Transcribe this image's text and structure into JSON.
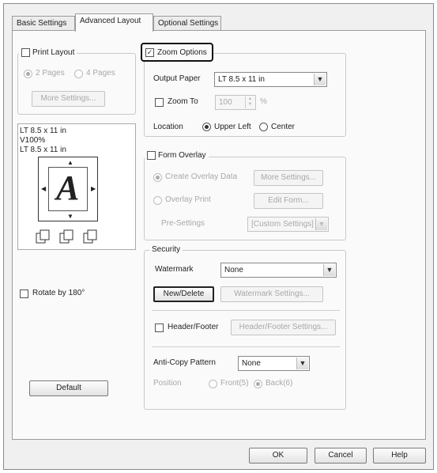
{
  "tabs": {
    "basic": "Basic Settings",
    "advanced": "Advanced Layout",
    "optional": "Optional Settings"
  },
  "print_layout": {
    "label": "Print Layout",
    "checked": false,
    "pages2": "2 Pages",
    "pages4": "4 Pages",
    "more_settings": "More Settings..."
  },
  "preview": {
    "line1": "LT 8.5 x 11 in",
    "line2": "V100%",
    "line3": "LT 8.5 x 11 in",
    "letter": "A"
  },
  "rotate": {
    "label": "Rotate by 180°",
    "checked": false
  },
  "default_button": "Default",
  "zoom": {
    "label": "Zoom Options",
    "checked": true,
    "output_paper_label": "Output Paper",
    "output_paper_value": "LT 8.5 x 11 in",
    "zoom_to_label": "Zoom To",
    "zoom_to_value": "100",
    "zoom_unit": "%",
    "location_label": "Location",
    "upper_left": "Upper Left",
    "center": "Center",
    "checkmark": "✓"
  },
  "form_overlay": {
    "label": "Form Overlay",
    "checked": false,
    "create": "Create Overlay Data",
    "more_settings": "More Settings...",
    "print": "Overlay Print",
    "edit_form": "Edit Form...",
    "presettings_label": "Pre-Settings",
    "presettings_value": "[Custom Settings]"
  },
  "security": {
    "legend": "Security",
    "watermark_label": "Watermark",
    "watermark_value": "None",
    "new_delete": "New/Delete",
    "watermark_settings": "Watermark Settings...",
    "header_footer_label": "Header/Footer",
    "header_footer_settings": "Header/Footer Settings...",
    "anticopy_label": "Anti-Copy Pattern",
    "anticopy_value": "None",
    "position_label": "Position",
    "front": "Front(5)",
    "back": "Back(6)"
  },
  "footer": {
    "ok": "OK",
    "cancel": "Cancel",
    "help": "Help"
  },
  "colors": {
    "dialog_bg": "#f0f0f0",
    "panel_bg": "#fafafa",
    "highlight_border": "#111111"
  }
}
